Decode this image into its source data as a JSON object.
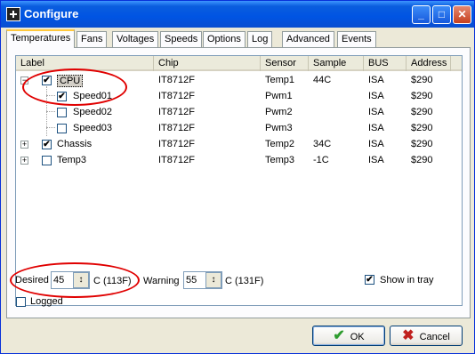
{
  "window": {
    "title": "Configure",
    "controls": {
      "minimize": "_",
      "maximize": "□",
      "close": "✕"
    }
  },
  "tabs": [
    "Temperatures",
    "Fans",
    "Voltages",
    "Speeds",
    "Options",
    "Log",
    "Advanced",
    "Events"
  ],
  "active_tab": "Temperatures",
  "list": {
    "columns": [
      "Label",
      "Chip",
      "Sensor",
      "Sample",
      "BUS",
      "Address"
    ],
    "rows": [
      {
        "expander": "−",
        "checked": true,
        "label": "CPU",
        "chip": "IT8712F",
        "sensor": "Temp1",
        "sample": "44C",
        "bus": "ISA",
        "address": "$290"
      },
      {
        "expander": "",
        "checked": true,
        "label": "Speed01",
        "chip": "IT8712F",
        "sensor": "Pwm1",
        "sample": "",
        "bus": "ISA",
        "address": "$290"
      },
      {
        "expander": "",
        "checked": false,
        "label": "Speed02",
        "chip": "IT8712F",
        "sensor": "Pwm2",
        "sample": "",
        "bus": "ISA",
        "address": "$290"
      },
      {
        "expander": "",
        "checked": false,
        "label": "Speed03",
        "chip": "IT8712F",
        "sensor": "Pwm3",
        "sample": "",
        "bus": "ISA",
        "address": "$290"
      },
      {
        "expander": "+",
        "checked": true,
        "label": "Chassis",
        "chip": "IT8712F",
        "sensor": "Temp2",
        "sample": "34C",
        "bus": "ISA",
        "address": "$290"
      },
      {
        "expander": "+",
        "checked": false,
        "label": "Temp3",
        "chip": "IT8712F",
        "sensor": "Temp3",
        "sample": "-1C",
        "bus": "ISA",
        "address": "$290"
      }
    ]
  },
  "settings": {
    "desired_label": "Desired",
    "desired_value": "45",
    "desired_unit": "C (113F)",
    "warning_label": "Warning",
    "warning_value": "55",
    "warning_unit": "C (131F)",
    "show_in_tray_label": "Show in tray",
    "show_in_tray": true,
    "logged_label": "Logged",
    "logged": false
  },
  "buttons": {
    "ok": "OK",
    "cancel": "Cancel"
  },
  "colors": {
    "annotation": "#E00000",
    "titlebar": "#0054E3"
  }
}
